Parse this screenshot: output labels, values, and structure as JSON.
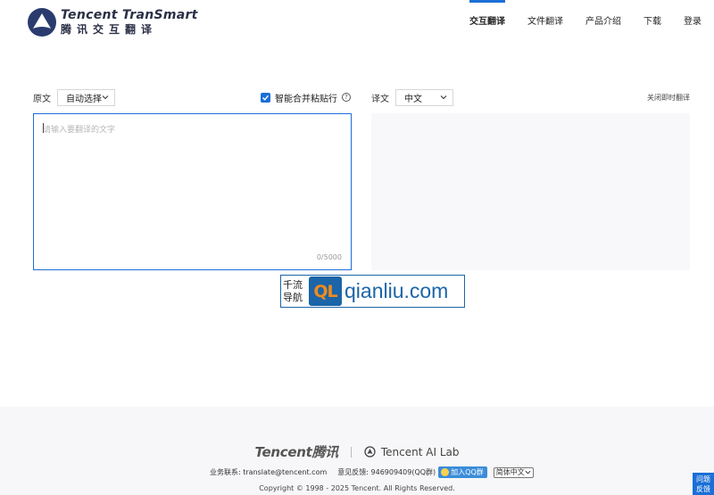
{
  "brand": {
    "name_en": "Tencent TranSmart",
    "name_cn": "腾讯交互翻译",
    "color": "#1b6fd6"
  },
  "nav": {
    "items": [
      {
        "label": "交互翻译",
        "active": true
      },
      {
        "label": "文件翻译",
        "active": false
      },
      {
        "label": "产品介绍",
        "active": false
      },
      {
        "label": "下载",
        "active": false
      },
      {
        "label": "登录",
        "active": false
      }
    ]
  },
  "source": {
    "label": "原文",
    "language": "自动选择",
    "merge_option": "智能合并粘贴行",
    "merge_checked": true,
    "help_icon": "question-circle-icon",
    "placeholder": "请输入要翻译的文字",
    "counter": "0/5000"
  },
  "target": {
    "label": "译文",
    "language": "中文",
    "close_live": "关闭即时翻译"
  },
  "watermark": {
    "line1": "千流",
    "line2": "导航",
    "logo": "QL",
    "site": "qianliu.com"
  },
  "footer": {
    "tencent_logo": "Tencent腾讯",
    "ailab": "Tencent AI Lab",
    "business": "业务联系: translate@tencent.com",
    "feedback": "意见反馈: 946909409(QQ群)",
    "qq_button": "加入QQ群",
    "language_select": "简体中文",
    "copyright": "Copyright © 1998 - 2025 Tencent. All Rights Reserved."
  },
  "floating_feedback": {
    "line1": "问题",
    "line2": "反馈"
  }
}
